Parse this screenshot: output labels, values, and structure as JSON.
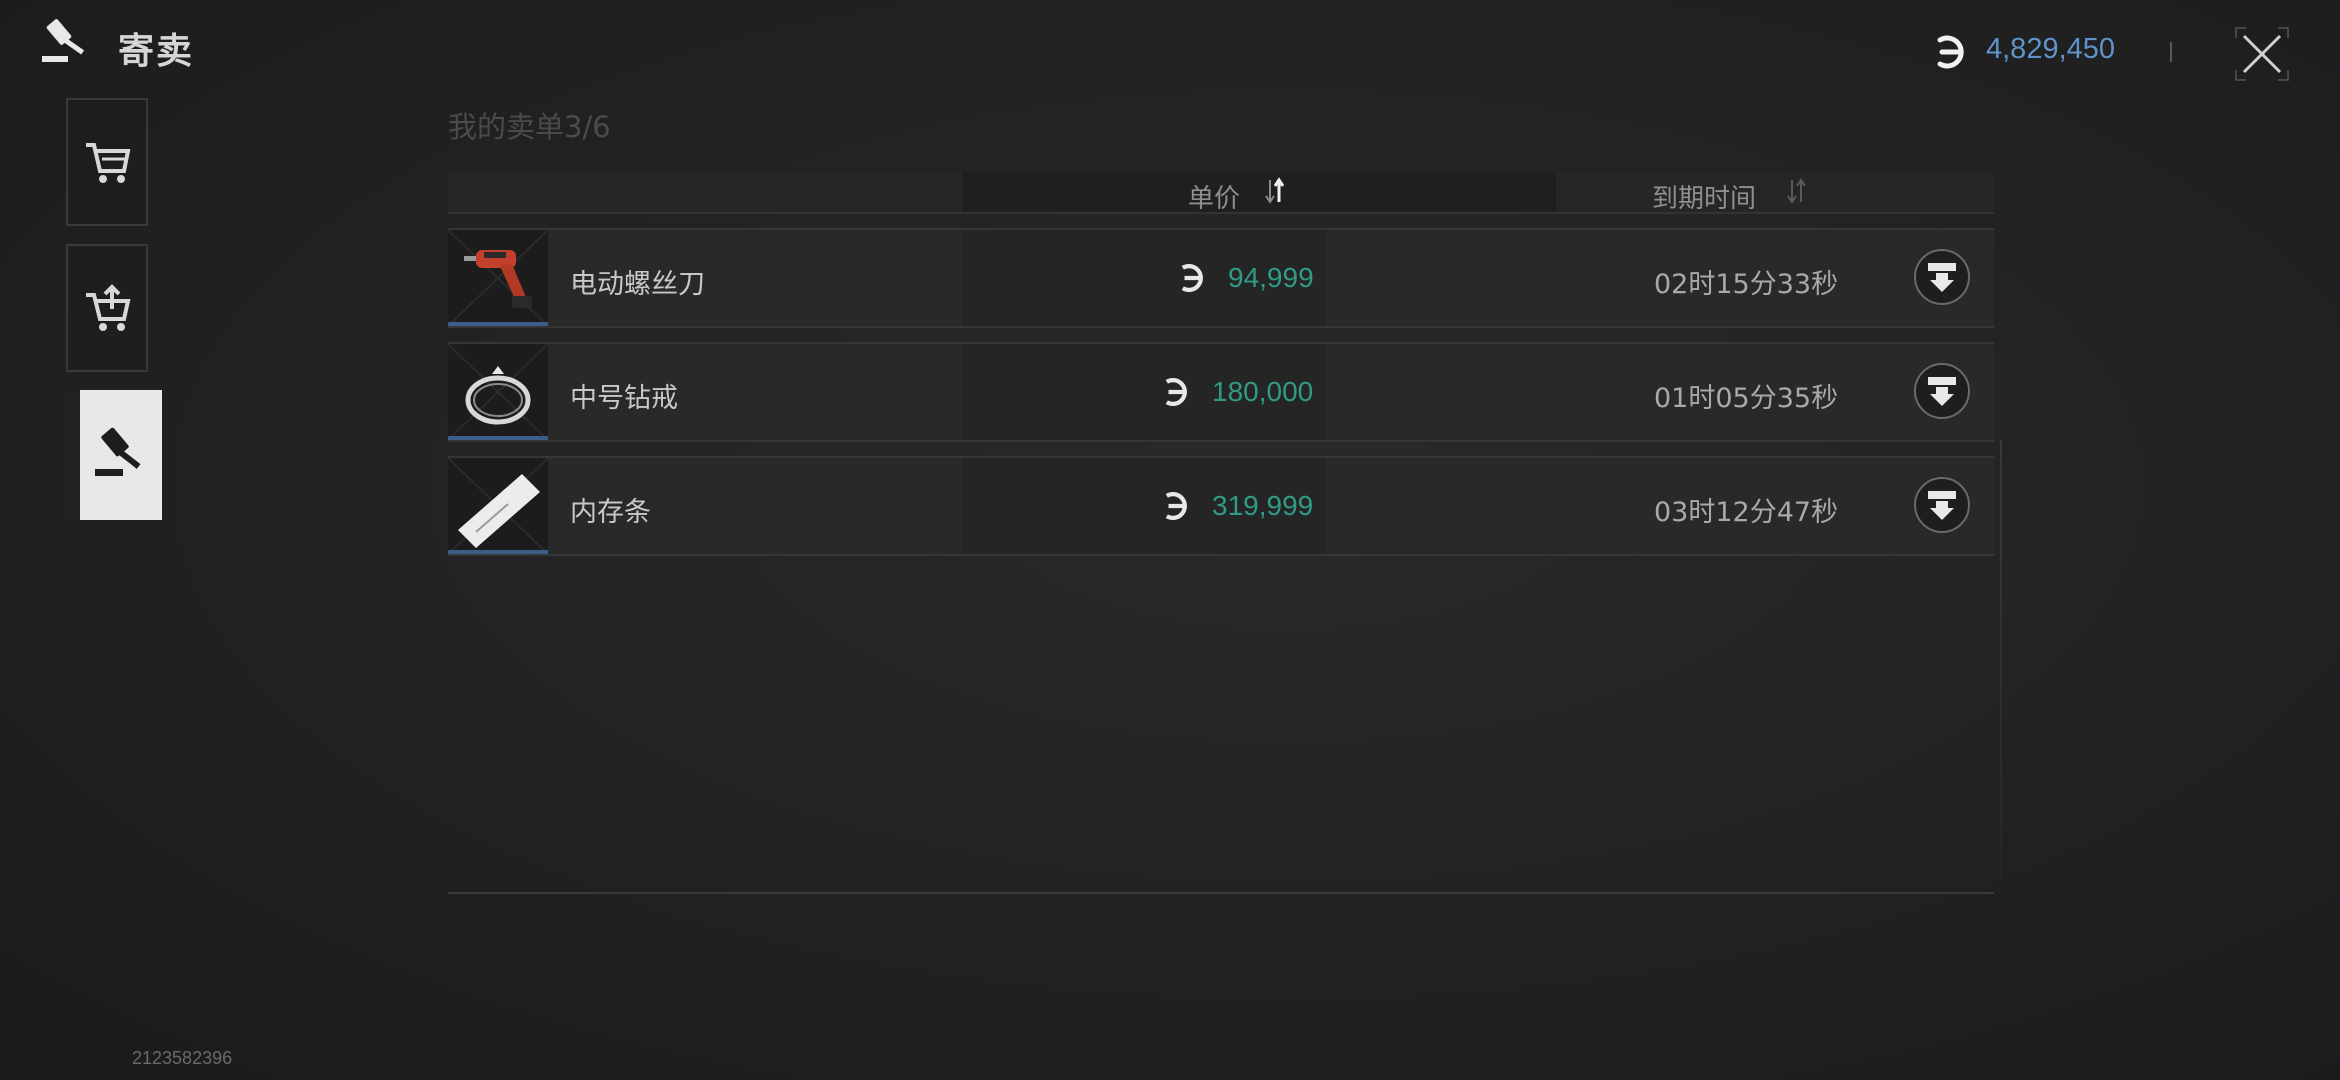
{
  "header": {
    "title": "寄卖",
    "balance": "4,829,450",
    "currency_icon": "currency-icon",
    "close_icon": "close-icon"
  },
  "sidebar": {
    "tabs": [
      {
        "icon": "cart-icon",
        "active": false
      },
      {
        "icon": "cart-upload-icon",
        "active": false
      },
      {
        "icon": "gavel-icon",
        "active": true
      }
    ]
  },
  "orders": {
    "heading": "我的卖单3/6",
    "columns": {
      "price": "单价",
      "expire": "到期时间"
    },
    "rows": [
      {
        "name": "电动螺丝刀",
        "price": "94,999",
        "time": "02时15分33秒",
        "thumb": "screwdriver-icon"
      },
      {
        "name": "中号钻戒",
        "price": "180,000",
        "time": "01时05分35秒",
        "thumb": "ring-icon"
      },
      {
        "name": "内存条",
        "price": "319,999",
        "time": "03时12分47秒",
        "thumb": "memory-stick-icon"
      }
    ]
  },
  "footer": {
    "id": "2123582396"
  },
  "colors": {
    "price": "#2f9b86",
    "balance": "#5f93c9",
    "accent": "#3c5f8a"
  }
}
